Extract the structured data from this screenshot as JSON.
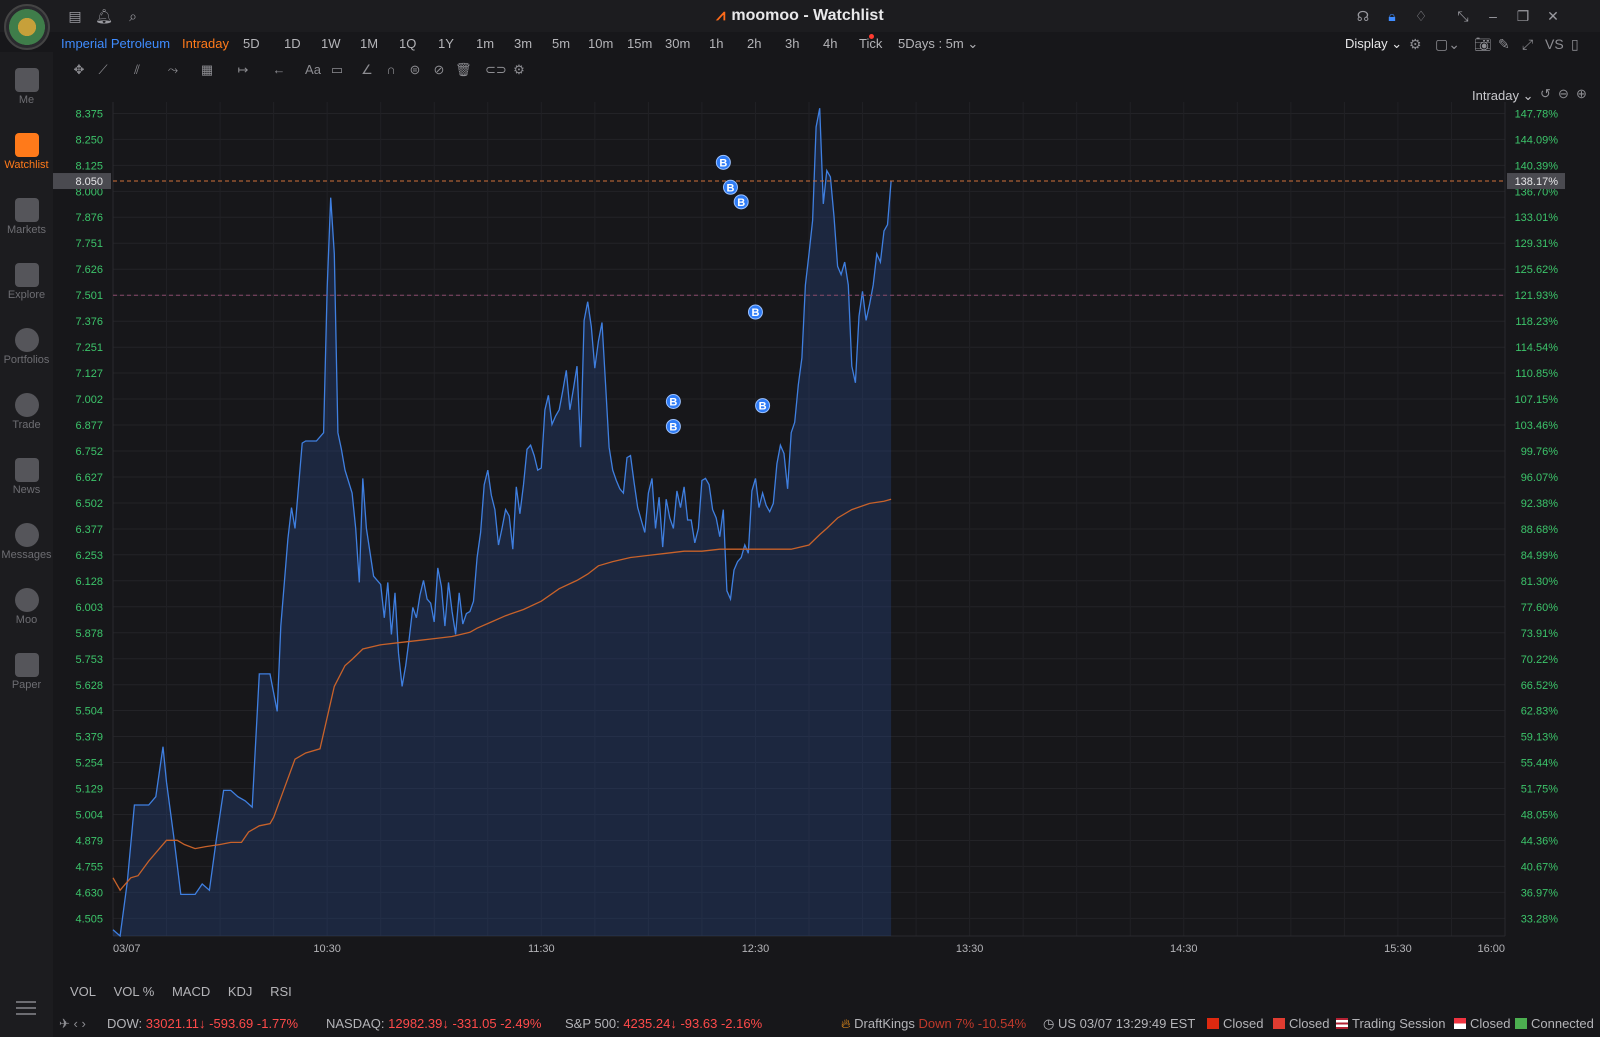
{
  "window": {
    "title": "moomoo - Watchlist",
    "brand": "moomoo"
  },
  "rail": [
    {
      "label": "Me",
      "icon": "user-icon"
    },
    {
      "label": "Watchlist",
      "icon": "watchlist-icon"
    },
    {
      "label": "Markets",
      "icon": "markets-icon"
    },
    {
      "label": "Explore",
      "icon": "explore-icon"
    },
    {
      "label": "Portfolios",
      "icon": "portfolio-icon"
    },
    {
      "label": "Trade",
      "icon": "trade-icon"
    },
    {
      "label": "News",
      "icon": "news-icon"
    },
    {
      "label": "Messages",
      "icon": "messages-icon"
    },
    {
      "label": "Moo",
      "icon": "moo-icon"
    },
    {
      "label": "Paper",
      "icon": "gamepad-icon"
    }
  ],
  "periodbar": {
    "stock_name": "Imperial Petroleum",
    "periods": [
      "Intraday",
      "5D",
      "1D",
      "1W",
      "1M",
      "1Q",
      "1Y",
      "1m",
      "3m",
      "5m",
      "10m",
      "15m",
      "30m",
      "1h",
      "2h",
      "3h",
      "4h",
      "Tick"
    ],
    "active_period": "Intraday",
    "multi_day": "5Days : 5m",
    "display_label": "Display",
    "vs_label": "VS"
  },
  "chart_header": {
    "mode": "Intraday"
  },
  "indicator_tabs": [
    "VOL",
    "VOL %",
    "MACD",
    "KDJ",
    "RSI"
  ],
  "status": {
    "dow": {
      "label": "DOW:",
      "value": "33021.11",
      "change": "-593.69",
      "pct": "-1.77%"
    },
    "nasdaq": {
      "label": "NASDAQ:",
      "value": "12982.39",
      "change": "-331.05",
      "pct": "-2.49%"
    },
    "sp500": {
      "label": "S&P 500:",
      "value": "4235.24",
      "change": "-93.63",
      "pct": "-2.16%"
    },
    "news": {
      "name": "DraftKings",
      "text": "Down 7% -10.54%"
    },
    "clock": "US 03/07 13:29:49 EST",
    "markets": [
      "Closed",
      "Closed",
      "Trading Session",
      "Closed"
    ],
    "connection": "Connected"
  },
  "chart_data": {
    "type": "line",
    "y_ticks": [
      "8.375",
      "8.250",
      "8.125",
      "8.000",
      "7.876",
      "7.751",
      "7.626",
      "7.501",
      "7.376",
      "7.251",
      "7.127",
      "7.002",
      "6.877",
      "6.752",
      "6.627",
      "6.502",
      "6.377",
      "6.253",
      "6.128",
      "6.003",
      "5.878",
      "5.753",
      "5.628",
      "5.504",
      "5.379",
      "5.254",
      "5.129",
      "5.004",
      "4.879",
      "4.755",
      "4.630",
      "4.505"
    ],
    "pct_ticks": [
      "147.78%",
      "144.09%",
      "140.39%",
      "136.70%",
      "133.01%",
      "129.31%",
      "125.62%",
      "121.93%",
      "118.23%",
      "114.54%",
      "110.85%",
      "107.15%",
      "103.46%",
      "99.76%",
      "96.07%",
      "92.38%",
      "88.68%",
      "84.99%",
      "81.30%",
      "77.60%",
      "73.91%",
      "70.22%",
      "66.52%",
      "62.83%",
      "59.13%",
      "55.44%",
      "51.75%",
      "48.05%",
      "44.36%",
      "40.67%",
      "36.97%",
      "33.28%"
    ],
    "x_ticks": [
      "03/07",
      "10:30",
      "11:30",
      "12:30",
      "13:30",
      "14:30",
      "15:30",
      "16:00"
    ],
    "ylim": [
      4.42,
      8.43
    ],
    "current_price": "8.050",
    "current_pct": "138.17%",
    "reference_price": 7.501,
    "buy_marker_label": "B",
    "buy_markers": [
      {
        "t": 741,
        "price": 8.14
      },
      {
        "t": 743,
        "price": 8.02
      },
      {
        "t": 746,
        "price": 7.95
      },
      {
        "t": 750,
        "price": 7.42
      },
      {
        "t": 752,
        "price": 6.97
      },
      {
        "t": 727,
        "price": 6.99
      },
      {
        "t": 727,
        "price": 6.87
      }
    ],
    "series": [
      {
        "color": "#3f7fe0",
        "points": [
          [
            570,
            4.45
          ],
          [
            572,
            4.42
          ],
          [
            574,
            4.68
          ],
          [
            576,
            5.05
          ],
          [
            580,
            5.05
          ],
          [
            582,
            5.09
          ],
          [
            584,
            5.33
          ],
          [
            585,
            5.16
          ],
          [
            587,
            4.9
          ],
          [
            589,
            4.62
          ],
          [
            591,
            4.62
          ],
          [
            593,
            4.62
          ],
          [
            595,
            4.67
          ],
          [
            597,
            4.64
          ],
          [
            599,
            4.89
          ],
          [
            601,
            5.12
          ],
          [
            603,
            5.12
          ],
          [
            605,
            5.09
          ],
          [
            607,
            5.07
          ],
          [
            609,
            5.04
          ],
          [
            611,
            5.68
          ],
          [
            613,
            5.68
          ],
          [
            614,
            5.68
          ],
          [
            616,
            5.5
          ],
          [
            617,
            5.91
          ],
          [
            619,
            6.33
          ],
          [
            620,
            6.48
          ],
          [
            621,
            6.38
          ],
          [
            623,
            6.79
          ],
          [
            624,
            6.8
          ],
          [
            627,
            6.8
          ],
          [
            629,
            6.84
          ],
          [
            630,
            7.54
          ],
          [
            631,
            7.97
          ],
          [
            632,
            7.7
          ],
          [
            633,
            6.84
          ],
          [
            634,
            6.76
          ],
          [
            635,
            6.66
          ],
          [
            637,
            6.55
          ],
          [
            638,
            6.38
          ],
          [
            639,
            6.12
          ],
          [
            640,
            6.62
          ],
          [
            641,
            6.38
          ],
          [
            643,
            6.15
          ],
          [
            645,
            6.11
          ],
          [
            646,
            5.95
          ],
          [
            647,
            6.12
          ],
          [
            648,
            5.87
          ],
          [
            649,
            6.07
          ],
          [
            650,
            5.78
          ],
          [
            651,
            5.62
          ],
          [
            652,
            5.72
          ],
          [
            653,
            5.85
          ],
          [
            654,
            6.0
          ],
          [
            655,
            5.95
          ],
          [
            656,
            6.06
          ],
          [
            657,
            6.13
          ],
          [
            658,
            6.04
          ],
          [
            659,
            6.02
          ],
          [
            660,
            5.93
          ],
          [
            661,
            6.19
          ],
          [
            662,
            6.1
          ],
          [
            663,
            5.91
          ],
          [
            664,
            6.12
          ],
          [
            665,
            5.98
          ],
          [
            666,
            5.87
          ],
          [
            667,
            6.07
          ],
          [
            668,
            5.92
          ],
          [
            669,
            5.97
          ],
          [
            670,
            5.98
          ],
          [
            671,
            6.03
          ],
          [
            672,
            6.24
          ],
          [
            673,
            6.36
          ],
          [
            674,
            6.59
          ],
          [
            675,
            6.66
          ],
          [
            676,
            6.54
          ],
          [
            677,
            6.47
          ],
          [
            678,
            6.3
          ],
          [
            679,
            6.38
          ],
          [
            680,
            6.47
          ],
          [
            681,
            6.44
          ],
          [
            682,
            6.28
          ],
          [
            683,
            6.58
          ],
          [
            684,
            6.45
          ],
          [
            685,
            6.59
          ],
          [
            686,
            6.76
          ],
          [
            687,
            6.78
          ],
          [
            688,
            6.73
          ],
          [
            689,
            6.66
          ],
          [
            690,
            6.67
          ],
          [
            691,
            6.95
          ],
          [
            692,
            7.02
          ],
          [
            693,
            6.88
          ],
          [
            694,
            6.92
          ],
          [
            695,
            6.95
          ],
          [
            696,
            7.04
          ],
          [
            697,
            7.14
          ],
          [
            698,
            6.95
          ],
          [
            699,
            7.05
          ],
          [
            700,
            7.16
          ],
          [
            701,
            6.77
          ],
          [
            702,
            7.38
          ],
          [
            703,
            7.47
          ],
          [
            704,
            7.35
          ],
          [
            705,
            7.15
          ],
          [
            706,
            7.28
          ],
          [
            707,
            7.37
          ],
          [
            708,
            7.07
          ],
          [
            709,
            6.77
          ],
          [
            710,
            6.66
          ],
          [
            711,
            6.61
          ],
          [
            712,
            6.57
          ],
          [
            713,
            6.55
          ],
          [
            714,
            6.72
          ],
          [
            715,
            6.73
          ],
          [
            716,
            6.6
          ],
          [
            717,
            6.48
          ],
          [
            718,
            6.42
          ],
          [
            719,
            6.36
          ],
          [
            720,
            6.55
          ],
          [
            721,
            6.62
          ],
          [
            722,
            6.38
          ],
          [
            723,
            6.53
          ],
          [
            724,
            6.29
          ],
          [
            725,
            6.52
          ],
          [
            726,
            6.43
          ],
          [
            727,
            6.38
          ],
          [
            728,
            6.56
          ],
          [
            729,
            6.48
          ],
          [
            730,
            6.58
          ],
          [
            731,
            6.42
          ],
          [
            732,
            6.42
          ],
          [
            733,
            6.31
          ],
          [
            734,
            6.38
          ],
          [
            735,
            6.61
          ],
          [
            736,
            6.62
          ],
          [
            737,
            6.59
          ],
          [
            738,
            6.47
          ],
          [
            739,
            6.43
          ],
          [
            740,
            6.34
          ],
          [
            741,
            6.47
          ],
          [
            742,
            6.08
          ],
          [
            743,
            6.04
          ],
          [
            744,
            6.18
          ],
          [
            745,
            6.22
          ],
          [
            746,
            6.24
          ],
          [
            747,
            6.3
          ],
          [
            748,
            6.26
          ],
          [
            749,
            6.56
          ],
          [
            750,
            6.62
          ],
          [
            751,
            6.48
          ],
          [
            752,
            6.55
          ],
          [
            753,
            6.49
          ],
          [
            754,
            6.46
          ],
          [
            755,
            6.5
          ],
          [
            756,
            6.69
          ],
          [
            757,
            6.78
          ],
          [
            758,
            6.74
          ],
          [
            759,
            6.57
          ],
          [
            760,
            6.84
          ],
          [
            761,
            6.89
          ],
          [
            762,
            7.07
          ],
          [
            763,
            7.2
          ],
          [
            764,
            7.55
          ],
          [
            765,
            7.7
          ],
          [
            766,
            7.86
          ],
          [
            767,
            8.31
          ],
          [
            768,
            8.4
          ],
          [
            769,
            7.94
          ],
          [
            770,
            8.1
          ],
          [
            771,
            8.07
          ],
          [
            772,
            7.88
          ],
          [
            773,
            7.64
          ],
          [
            774,
            7.6
          ],
          [
            775,
            7.66
          ],
          [
            776,
            7.55
          ],
          [
            777,
            7.16
          ],
          [
            778,
            7.08
          ],
          [
            779,
            7.4
          ],
          [
            780,
            7.52
          ],
          [
            781,
            7.38
          ],
          [
            782,
            7.46
          ],
          [
            783,
            7.55
          ],
          [
            784,
            7.7
          ],
          [
            785,
            7.66
          ],
          [
            786,
            7.81
          ],
          [
            787,
            7.84
          ],
          [
            788,
            8.05
          ]
        ]
      },
      {
        "color": "#c8622a",
        "points": [
          [
            570,
            4.7
          ],
          [
            572,
            4.64
          ],
          [
            575,
            4.7
          ],
          [
            577,
            4.71
          ],
          [
            580,
            4.78
          ],
          [
            585,
            4.88
          ],
          [
            588,
            4.88
          ],
          [
            590,
            4.86
          ],
          [
            593,
            4.84
          ],
          [
            596,
            4.85
          ],
          [
            600,
            4.86
          ],
          [
            603,
            4.87
          ],
          [
            606,
            4.87
          ],
          [
            608,
            4.92
          ],
          [
            611,
            4.95
          ],
          [
            614,
            4.96
          ],
          [
            615,
            4.99
          ],
          [
            618,
            5.13
          ],
          [
            621,
            5.27
          ],
          [
            624,
            5.3
          ],
          [
            628,
            5.32
          ],
          [
            632,
            5.62
          ],
          [
            635,
            5.72
          ],
          [
            637,
            5.75
          ],
          [
            640,
            5.8
          ],
          [
            645,
            5.82
          ],
          [
            650,
            5.83
          ],
          [
            655,
            5.84
          ],
          [
            660,
            5.85
          ],
          [
            665,
            5.86
          ],
          [
            670,
            5.88
          ],
          [
            672,
            5.9
          ],
          [
            676,
            5.93
          ],
          [
            680,
            5.96
          ],
          [
            685,
            5.99
          ],
          [
            690,
            6.03
          ],
          [
            695,
            6.09
          ],
          [
            700,
            6.13
          ],
          [
            703,
            6.16
          ],
          [
            706,
            6.2
          ],
          [
            710,
            6.22
          ],
          [
            715,
            6.24
          ],
          [
            720,
            6.25
          ],
          [
            725,
            6.26
          ],
          [
            730,
            6.27
          ],
          [
            735,
            6.27
          ],
          [
            740,
            6.28
          ],
          [
            745,
            6.28
          ],
          [
            750,
            6.28
          ],
          [
            755,
            6.28
          ],
          [
            760,
            6.28
          ],
          [
            765,
            6.3
          ],
          [
            768,
            6.35
          ],
          [
            770,
            6.38
          ],
          [
            773,
            6.43
          ],
          [
            777,
            6.47
          ],
          [
            782,
            6.5
          ],
          [
            786,
            6.51
          ],
          [
            788,
            6.52
          ]
        ]
      }
    ]
  }
}
